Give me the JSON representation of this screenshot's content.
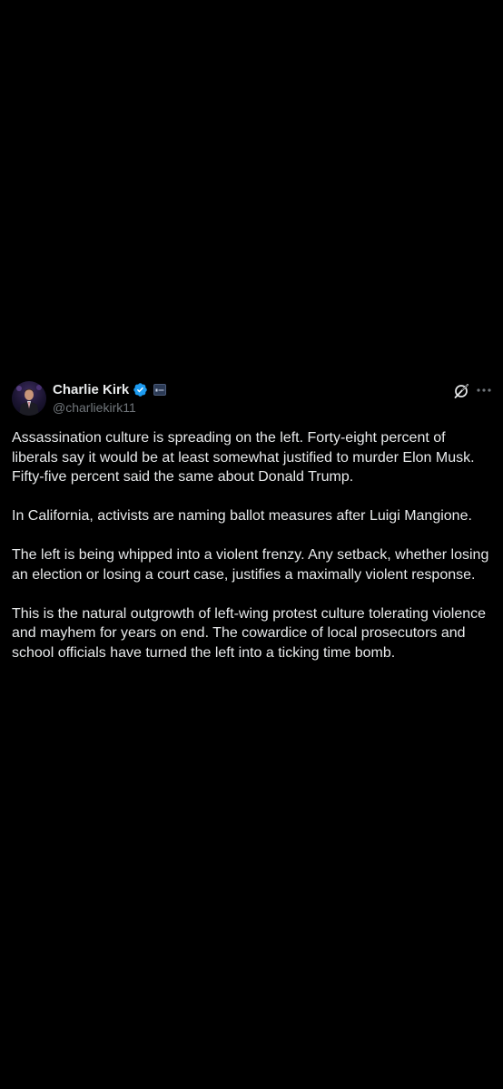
{
  "author": {
    "display_name": "Charlie Kirk",
    "handle": "@charliekirk11",
    "verified": true,
    "accent_color": "#1d9bf0"
  },
  "icons": {
    "verified": "verified-badge-icon",
    "affiliate": "affiliate-badge-icon",
    "grok": "grok-icon",
    "more": "more-options-icon"
  },
  "tweet": {
    "paragraphs": [
      "Assassination culture is spreading on the left. Forty-eight percent of liberals say it would be at least somewhat justified to murder Elon Musk. Fifty-five percent said the same about Donald Trump.",
      "In California, activists are naming ballot measures after Luigi Mangione.",
      "The left is being whipped into a violent frenzy. Any setback, whether losing an election or losing a court case, justifies a maximally violent response.",
      "This is the natural outgrowth of left-wing protest culture tolerating violence and mayhem for years on end. The cowardice of local prosecutors and school officials have turned the left into a ticking time bomb."
    ]
  }
}
